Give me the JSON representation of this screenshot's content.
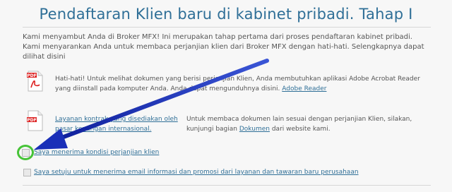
{
  "page": {
    "title": "Pendaftaran Klien baru di kabinet pribadi. Tahap I",
    "intro": "Kami menyambut Anda di Broker MFX! Ini merupakan tahap pertama dari proses pendaftaran kabinet pribadi. Kami menyarankan Anda untuk membaca perjanjian klien dari Broker MFX dengan hati-hati. Selengkapnya dapat dilihat disini"
  },
  "warning": {
    "icon": "pdf-icon",
    "text": "Hati-hati! Untuk melihat dokumen yang berisi perjanjian Klien, Anda membutuhkan aplikasi Adobe Acrobat Reader yang diinstall pada komputer Anda. Anda dapat mengunduhnya disini.",
    "link": "Adobe Reader"
  },
  "contract": {
    "icon": "pdf-icon",
    "link": "Layanan kontrak yang disediakan oleh pasar keuangan internasional.",
    "text_before": "Untuk membaca dokumen lain sesuai dengan perjanjian Klien, silakan, kunjungi bagian",
    "docs_link": "Dokumen",
    "text_after": "dari website kami."
  },
  "checkboxes": {
    "accept_terms": "Saya menerima kondisi perjanjian klien",
    "accept_email": "Saya setuju untuk menerima email informasi dan promosi dari layanan dan tawaran baru perusahaan"
  },
  "colors": {
    "accent": "#2f6f97",
    "annotation_arrow": "#1a2fb8",
    "annotation_circle": "#46c337"
  }
}
